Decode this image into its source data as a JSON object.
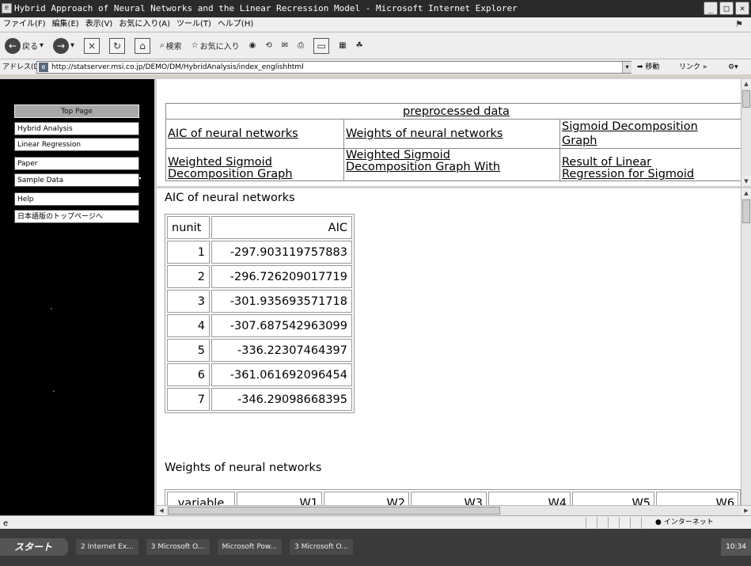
{
  "window": {
    "title": "Hybrid Approach of Neural Networks and the Linear Recression Model - Microsoft Internet Explorer",
    "controls": [
      "_",
      "□",
      "×"
    ]
  },
  "menubar": {
    "items": [
      "ファイル(F)",
      "編集(E)",
      "表示(V)",
      "お気に入り(A)",
      "ツール(T)",
      "ヘルプ(H)"
    ]
  },
  "toolbar": {
    "back_label": "戻る",
    "search_label": "検索",
    "favorites_label": "お気に入り"
  },
  "addressbar": {
    "label": "アドレス(D)",
    "url": "http://statserver.msi.co.jp/DEMO/DM/HybridAnalysis/index_englishhtml",
    "go_label": "移動",
    "links_label": "リンク »"
  },
  "leftnav": {
    "top_page": "Top Page",
    "items": [
      "Hybrid Analysis",
      "Linear Regression",
      "Paper",
      "Sample Data",
      "Help",
      "日本語版のトップページへ"
    ]
  },
  "topframe": {
    "links": {
      "preprocessed": "preprocessed data",
      "aic": "AIC of neural networks",
      "weights": "Weights of neural networks",
      "sigmoid_graph_l1": "Sigmoid Decomposition",
      "sigmoid_graph_l2": "Graph",
      "weighted_sigmoid_l1": "Weighted Sigmoid",
      "weighted_sigmoid_l2": "Decomposition Graph",
      "weighted_with_l1": "Weighted Sigmoid",
      "weighted_with_l2": "Decomposition Graph With",
      "result_linear_l1": "Result of Linear",
      "result_linear_l2": "Regression for Sigmoid"
    }
  },
  "aic_section": {
    "title": "AIC of neural networks",
    "headers": [
      "nunit",
      "AIC"
    ],
    "rows": [
      [
        "1",
        "-297.903119757883"
      ],
      [
        "2",
        "-296.726209017719"
      ],
      [
        "3",
        "-301.935693571718"
      ],
      [
        "4",
        "-307.687542963099"
      ],
      [
        "5",
        "-336.22307464397"
      ],
      [
        "6",
        "-361.061692096454"
      ],
      [
        "7",
        "-346.29098668395"
      ]
    ]
  },
  "weights_section": {
    "title": "Weights of neural networks",
    "headers": [
      "variable",
      "W1",
      "W2",
      "W3",
      "W4",
      "W5",
      "W6"
    ]
  },
  "statusbar": {
    "zone": "インターネット"
  },
  "taskbar": {
    "start": "スタート",
    "tasks": [
      "2 Internet Ex...",
      "3 Microsoft O...",
      "Microsoft Pow...",
      "3 Microsoft O..."
    ],
    "clock": "10:34"
  }
}
